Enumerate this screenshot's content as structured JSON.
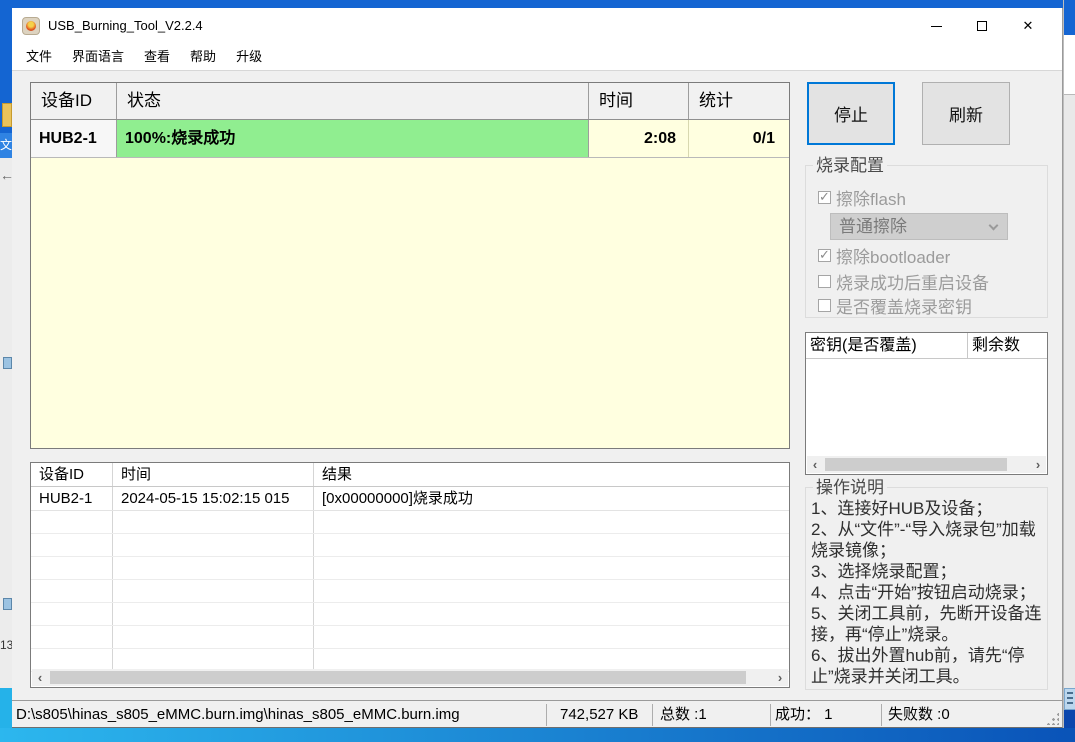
{
  "window": {
    "title": "USB_Burning_Tool_V2.2.4",
    "close_glyph": "✕"
  },
  "menu": {
    "items": [
      "文件",
      "界面语言",
      "查看",
      "帮助",
      "升级"
    ]
  },
  "device_table": {
    "headers": [
      "设备ID",
      "状态",
      "时间",
      "统计"
    ],
    "rows": [
      {
        "id": "HUB2-1",
        "status": "100%:烧录成功",
        "time": "2:08",
        "stat": "0/1"
      }
    ]
  },
  "actions": {
    "stop": "停止",
    "refresh": "刷新"
  },
  "burn_config": {
    "title": "烧录配置",
    "options": [
      {
        "label": "擦除flash",
        "checked": true
      },
      {
        "label": "擦除bootloader",
        "checked": true
      },
      {
        "label": "烧录成功后重启设备",
        "checked": false
      },
      {
        "label": "是否覆盖烧录密钥",
        "checked": false
      }
    ],
    "erase_mode": "普通擦除"
  },
  "key_table": {
    "headers": [
      "密钥(是否覆盖)",
      "剩余数"
    ],
    "rows": []
  },
  "instructions": {
    "title": "操作说明",
    "lines": [
      "1、连接好HUB及设备；",
      "2、从“文件”-“导入烧录包”加载烧录镜像；",
      "3、选择烧录配置；",
      "4、点击“开始”按钮启动烧录；",
      "5、关闭工具前，先断开设备连接，再“停止”烧录。",
      "6、拔出外置hub前，请先“停止”烧录并关闭工具。"
    ]
  },
  "log_table": {
    "headers": [
      "设备ID",
      "时间",
      "结果"
    ],
    "rows": [
      {
        "id": "HUB2-1",
        "time": "2024-05-15 15:02:15 015",
        "result": "[0x00000000]烧录成功"
      }
    ]
  },
  "status_bar": {
    "path": "D:\\s805\\hinas_s805_eMMC.burn.img\\hinas_s805_eMMC.burn.img",
    "size": "742,527 KB",
    "total": "总数 :1",
    "success": "成功： 1",
    "failed": "失败数 :0"
  },
  "colors": {
    "accent_focus": "#0078d7",
    "success_green": "#90ee90",
    "table_body_yellow": "#ffffe0",
    "desktop_blue": "#1465d2",
    "desktop_cyan": "#2cb7ee"
  }
}
